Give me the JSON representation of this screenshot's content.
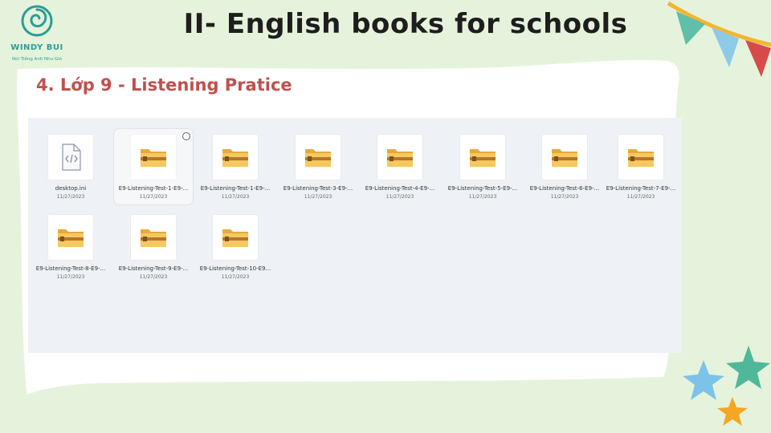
{
  "header": {
    "title": "II- English books for schools",
    "subtitle": "4. Lớp 9 - Listening Pratice"
  },
  "logo": {
    "brand": "WINDY BUI",
    "tagline": "Nói Tiếng Anh Như Gió"
  },
  "explorer": {
    "files": [
      {
        "name": "desktop.ini",
        "date": "11/27/2023",
        "icon": "ini-file-icon"
      },
      {
        "name": "E9-Listening-Test-1-E9-...",
        "date": "11/27/2023",
        "icon": "zip-folder-icon",
        "selected": true
      },
      {
        "name": "E9-Listening-Test-1-E9-...",
        "date": "11/27/2023",
        "icon": "zip-folder-icon"
      },
      {
        "name": "E9-Listening-Test-3-E9-...",
        "date": "11/27/2023",
        "icon": "zip-folder-icon"
      },
      {
        "name": "E9-Listening-Test-4-E9-...",
        "date": "11/27/2023",
        "icon": "zip-folder-icon"
      },
      {
        "name": "E9-Listening-Test-5-E9-...",
        "date": "11/27/2023",
        "icon": "zip-folder-icon"
      },
      {
        "name": "E9-Listening-Test-6-E9-...",
        "date": "11/27/2023",
        "icon": "zip-folder-icon"
      },
      {
        "name": "E9-Listening-Test-7-E9-...",
        "date": "11/27/2023",
        "icon": "zip-folder-icon"
      },
      {
        "name": "E9-Listening-Test-8-E9-...",
        "date": "11/27/2023",
        "icon": "zip-folder-icon"
      },
      {
        "name": "E9-Listening-Test-9-E9-...",
        "date": "11/27/2023",
        "icon": "zip-folder-icon"
      },
      {
        "name": "E9-Listening-Test-10-E9...",
        "date": "11/27/2023",
        "icon": "zip-folder-icon"
      }
    ]
  },
  "colors": {
    "background": "#e6f3dc",
    "subtitle": "#c0504d",
    "brand": "#2a9d96",
    "folder": "#f6c85f"
  }
}
